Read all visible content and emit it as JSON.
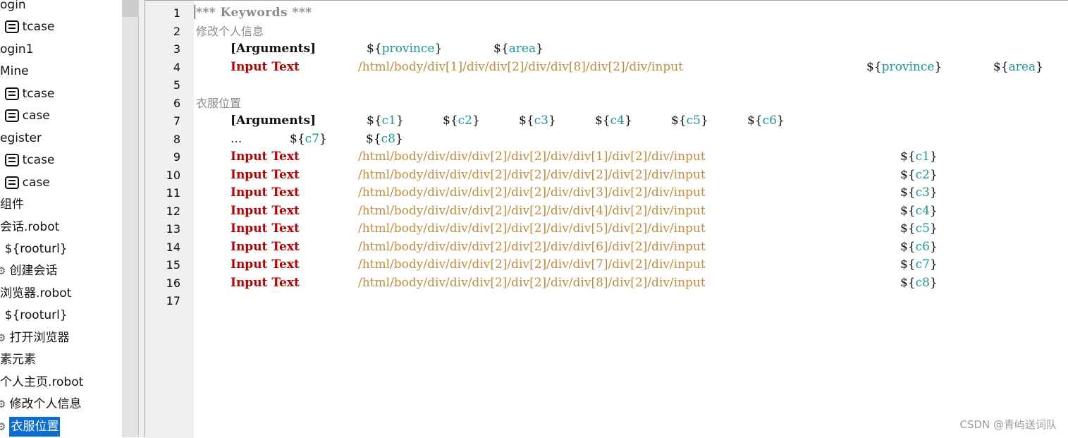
{
  "tree": {
    "items": [
      {
        "label": "ogin",
        "kind": "text"
      },
      {
        "prefix": "]",
        "label": "tcase",
        "kind": "case"
      },
      {
        "label": "ogin1",
        "kind": "text"
      },
      {
        "label": "Mine",
        "kind": "text"
      },
      {
        "prefix": "]",
        "label": "tcase",
        "kind": "case"
      },
      {
        "prefix": "]",
        "label": "case",
        "kind": "case"
      },
      {
        "label": "egister",
        "kind": "text"
      },
      {
        "prefix": "]",
        "label": "tcase",
        "kind": "case"
      },
      {
        "prefix": "]",
        "label": "case",
        "kind": "case"
      },
      {
        "label": "组件",
        "kind": "text"
      },
      {
        "label": "会话.robot",
        "kind": "text"
      },
      {
        "prefix": ")",
        "label": "${rooturl}",
        "kind": "var"
      },
      {
        "label": "创建会话",
        "kind": "keyword"
      },
      {
        "label": "浏览器.robot",
        "kind": "text"
      },
      {
        "prefix": ")",
        "label": "${rooturl}",
        "kind": "var"
      },
      {
        "label": "打开浏览器",
        "kind": "keyword"
      },
      {
        "label": "素元素",
        "kind": "text"
      },
      {
        "label": "个人主页.robot",
        "kind": "text"
      },
      {
        "label": "修改个人信息",
        "kind": "keyword"
      },
      {
        "label": "衣服位置",
        "kind": "keyword",
        "selected": true
      }
    ]
  },
  "editor": {
    "line_numbers": [
      "1",
      "2",
      "3",
      "4",
      "5",
      "6",
      "7",
      "8",
      "9",
      "10",
      "11",
      "12",
      "13",
      "14",
      "15",
      "16",
      "17"
    ],
    "header": "*** Keywords ***",
    "keyword1": {
      "name": "修改个人信息",
      "arguments_label": "[Arguments]",
      "args": [
        "province",
        "area"
      ],
      "step": {
        "kw": "Input Text",
        "path": "/html/body/div[1]/div/div[2]/div/div[8]/div[2]/div/input",
        "vars": [
          "province",
          "area"
        ]
      }
    },
    "keyword2": {
      "name": "衣服位置",
      "arguments_label": "[Arguments]",
      "args": [
        "c1",
        "c2",
        "c3",
        "c4",
        "c5",
        "c6"
      ],
      "continuation": "...",
      "cont_args": [
        "c7",
        "c8"
      ],
      "steps": [
        {
          "kw": "Input Text",
          "path": "/html/body/div/div/div[2]/div[2]/div/div[1]/div[2]/div/input",
          "var": "c1"
        },
        {
          "kw": "Input Text",
          "path": "/html/body/div/div/div[2]/div[2]/div/div[2]/div[2]/div/input",
          "var": "c2"
        },
        {
          "kw": "Input Text",
          "path": "/html/body/div/div/div[2]/div[2]/div/div[3]/div[2]/div/input",
          "var": "c3"
        },
        {
          "kw": "Input Text",
          "path": "/html/body/div/div/div[2]/div[2]/div/div[4]/div[2]/div/input",
          "var": "c4"
        },
        {
          "kw": "Input Text",
          "path": "/html/body/div/div/div[2]/div[2]/div/div[5]/div[2]/div/input",
          "var": "c5"
        },
        {
          "kw": "Input Text",
          "path": "/html/body/div/div/div[2]/div[2]/div/div[6]/div[2]/div/input",
          "var": "c6"
        },
        {
          "kw": "Input Text",
          "path": "/html/body/div/div/div[2]/div[2]/div/div[7]/div[2]/div/input",
          "var": "c7"
        },
        {
          "kw": "Input Text",
          "path": "/html/body/div/div/div[2]/div[2]/div/div[8]/div[2]/div/input",
          "var": "c8"
        }
      ]
    }
  },
  "watermark": "CSDN @青屿送词队",
  "colors": {
    "keyword": "#c00000",
    "path": "#c98a3a",
    "variable": "#169a9a",
    "comment": "#8a8a8a",
    "selection": "#0a6cd6"
  }
}
